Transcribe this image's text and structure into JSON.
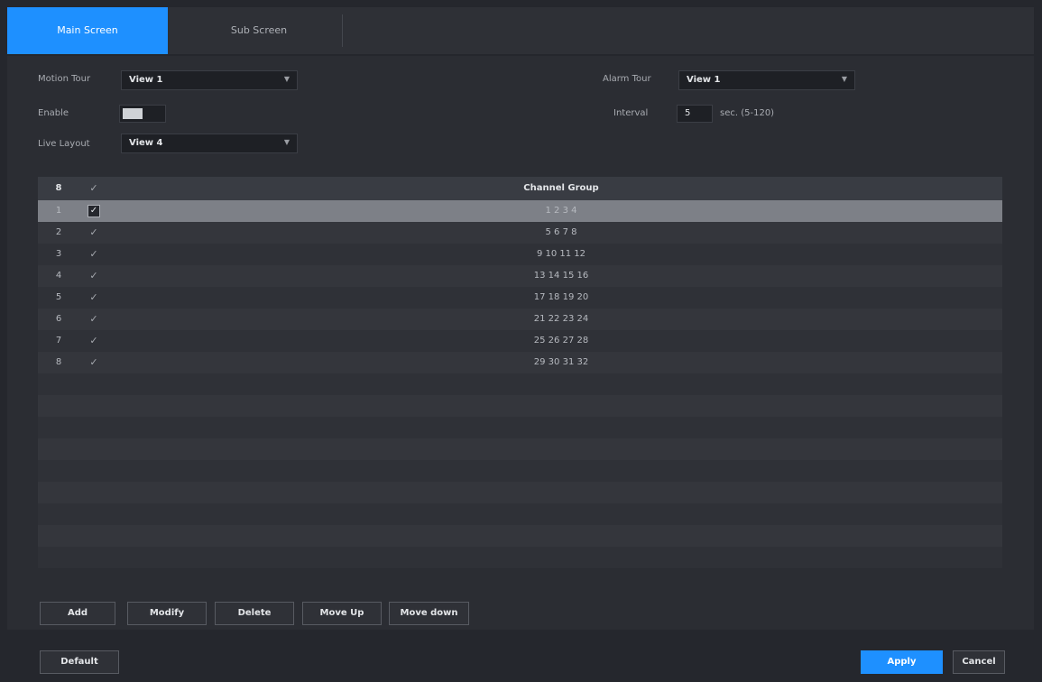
{
  "tabs": [
    {
      "label": "Main Screen",
      "active": true
    },
    {
      "label": "Sub Screen",
      "active": false
    }
  ],
  "settings": {
    "motion_tour_label": "Motion Tour",
    "motion_tour_value": "View 1",
    "alarm_tour_label": "Alarm Tour",
    "alarm_tour_value": "View 1",
    "enable_label": "Enable",
    "enable_state": "on",
    "interval_label": "Interval",
    "interval_value": "5",
    "interval_unit": "sec. (5-120)",
    "live_layout_label": "Live Layout",
    "live_layout_value": "View 4"
  },
  "table": {
    "header_num": "8",
    "header_check": "✓",
    "header_group": "Channel Group",
    "rows": [
      {
        "num": "1",
        "checked": true,
        "group": "1 2 3 4"
      },
      {
        "num": "2",
        "checked": false,
        "group": "5 6 7 8"
      },
      {
        "num": "3",
        "checked": false,
        "group": "9 10 11 12"
      },
      {
        "num": "4",
        "checked": false,
        "group": "13 14 15 16"
      },
      {
        "num": "5",
        "checked": false,
        "group": "17 18 19 20"
      },
      {
        "num": "6",
        "checked": false,
        "group": "21 22 23 24"
      },
      {
        "num": "7",
        "checked": false,
        "group": "25 26 27 28"
      },
      {
        "num": "8",
        "checked": false,
        "group": "29 30 31 32"
      }
    ]
  },
  "actions": {
    "add": "Add",
    "modify": "Modify",
    "delete": "Delete",
    "move_up": "Move Up",
    "move_down": "Move down"
  },
  "footer": {
    "default": "Default",
    "apply": "Apply",
    "cancel": "Cancel"
  },
  "colors": {
    "accent": "#1e90ff",
    "background": "#25272d"
  }
}
